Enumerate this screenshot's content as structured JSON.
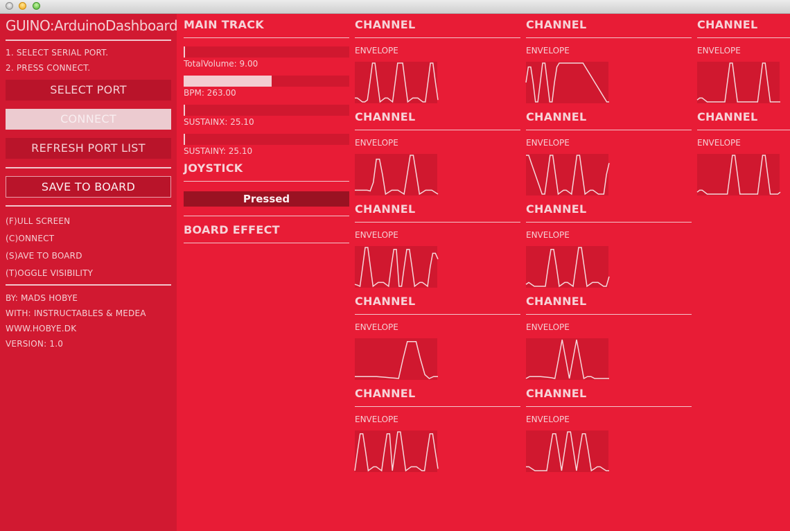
{
  "window": {
    "buttons": [
      "close",
      "minimize",
      "maximize"
    ]
  },
  "sidebar": {
    "title": "GUINO:ArduinoDashboard",
    "steps": [
      "1. SELECT SERIAL PORT.",
      "2. PRESS CONNECT."
    ],
    "buttons": {
      "select_port": "SELECT PORT",
      "connect": "CONNECT",
      "refresh": "REFRESH PORT LIST",
      "save": "SAVE TO BOARD"
    },
    "shortcuts": [
      "(F)ULL SCREEN",
      "(C)ONNECT",
      "(S)AVE TO BOARD",
      "(T)OGGLE VISIBILITY"
    ],
    "credits": [
      "BY: MADS HOBYE",
      "WITH: INSTRUCTABLES & MEDEA",
      "WWW.HOBYE.DK",
      "VERSION: 1.0"
    ]
  },
  "main_track": {
    "title": "MAIN TRACK",
    "sliders": [
      {
        "label": "TotalVolume: 9.00",
        "fraction": 0.0
      },
      {
        "label": "BPM: 263.00",
        "fraction": 0.53
      },
      {
        "label": "SUSTAINX: 25.10",
        "fraction": 0.0
      },
      {
        "label": "SUSTAINY: 25.10",
        "fraction": 0.0
      }
    ],
    "joystick_title": "JOYSTICK",
    "joystick_state": "Pressed",
    "board_effect_title": "BOARD EFFECT"
  },
  "channels": [
    {
      "title": "CHANNEL",
      "subtitle": "ENVELOPE",
      "envelope": [
        0.1,
        0.1,
        0.05,
        0,
        0,
        0.05,
        0.5,
        1,
        1,
        0.5,
        0,
        0.05,
        0.1,
        0.1,
        0.05,
        0,
        0.5,
        1,
        1,
        1,
        0.5,
        0,
        0.05,
        0.1,
        0.1,
        0.1,
        0.05,
        0,
        0,
        0.5,
        1,
        1,
        0.5,
        0.05
      ]
    },
    {
      "title": "CHANNEL",
      "subtitle": "ENVELOPE",
      "envelope": [
        0.5,
        0.9,
        0.9,
        0.5,
        0,
        0,
        0.5,
        1,
        1,
        0.5,
        0,
        0,
        0.5,
        0.9,
        1,
        1,
        1,
        1,
        1,
        1,
        1,
        1,
        1,
        1,
        1,
        0.9,
        0.8,
        0.7,
        0.6,
        0.5,
        0.4,
        0.3,
        0.2,
        0.1,
        0,
        0
      ]
    },
    {
      "title": "CHANNEL",
      "subtitle": "ENVELOPE",
      "envelope": [
        0.05,
        0.1,
        0.1,
        0.05,
        0,
        0,
        0,
        0,
        0,
        0,
        0,
        0,
        0.5,
        1,
        1,
        0.5,
        0,
        0,
        0,
        0,
        0,
        0,
        0,
        0,
        0,
        0.5,
        1,
        1,
        0.5,
        0,
        0,
        0,
        0,
        0
      ]
    },
    {
      "title": "CHANNEL",
      "subtitle": "ENVELOPE",
      "envelope": [
        0.1,
        0.1,
        0.1,
        0.1,
        0.1,
        0.08,
        0.3,
        0.9,
        0.9,
        0.5,
        0,
        0.05,
        0.1,
        0.1,
        0.1,
        0.05,
        0,
        0.5,
        1,
        1,
        0.5,
        0,
        0.05,
        0.1,
        0.1,
        0.1,
        0.05,
        0
      ]
    },
    {
      "title": "CHANNEL",
      "subtitle": "ENVELOPE",
      "envelope": [
        1,
        1,
        0.8,
        0.6,
        0.4,
        0.2,
        0,
        0,
        0.5,
        1,
        1,
        0.5,
        0,
        0.05,
        0.1,
        0.1,
        0.05,
        0,
        0.5,
        1,
        1,
        0.5,
        0,
        0.05,
        0.1,
        0.1,
        0.05,
        0,
        0,
        0,
        0.5,
        0.8
      ]
    },
    {
      "title": "CHANNEL",
      "subtitle": "ENVELOPE",
      "envelope": [
        0.05,
        0.1,
        0.1,
        0.05,
        0,
        0,
        0,
        0,
        0,
        0,
        0,
        0,
        0,
        0.5,
        1,
        1,
        0.5,
        0,
        0,
        0,
        0,
        0,
        0,
        0,
        0,
        0.5,
        1,
        1,
        0.5,
        0,
        0,
        0,
        0,
        0.05
      ]
    },
    {
      "title": "CHANNEL",
      "subtitle": "ENVELOPE",
      "envelope": [
        0.05,
        0.03,
        0,
        0.5,
        1,
        1,
        0.5,
        0,
        0.05,
        0.1,
        0.1,
        0.1,
        0.05,
        0,
        0.5,
        0.95,
        0.95,
        0,
        0,
        0.5,
        0.95,
        0.95,
        0.5,
        0,
        0.05,
        0.1,
        0.1,
        0.05,
        0,
        0.5,
        0.85,
        0.85,
        0.7
      ]
    },
    {
      "title": "CHANNEL",
      "subtitle": "ENVELOPE",
      "envelope": [
        0.05,
        0.1,
        0.05,
        0,
        0,
        0,
        0,
        0,
        0.5,
        0.95,
        0.95,
        0.5,
        0,
        0.05,
        0.1,
        0.1,
        0.05,
        0,
        0.5,
        1,
        1,
        0.5,
        0,
        0.05,
        0.1,
        0.1,
        0.1,
        0.05,
        0,
        0,
        0.25
      ]
    },
    {
      "title": "CHANNEL",
      "subtitle": "ENVELOPE",
      "envelope": [
        0.05,
        0.05,
        0.05,
        0.05,
        0.05,
        0.05,
        0.04,
        0.03,
        0.02,
        0.01,
        0,
        0.5,
        0.95,
        0.95,
        0.95,
        0.5,
        0.1,
        0,
        0.05,
        0.05
      ]
    },
    {
      "title": "CHANNEL",
      "subtitle": "ENVELOPE",
      "envelope": [
        0,
        0.05,
        0.05,
        0.05,
        0.05,
        0.04,
        0.03,
        0.02,
        0,
        0.5,
        1,
        0.5,
        0,
        0.5,
        1,
        0.5,
        0,
        0.05,
        0.05,
        0,
        0,
        0,
        0,
        0
      ]
    },
    {
      "title": "CHANNEL",
      "subtitle": "ENVELOPE",
      "envelope": [
        0,
        0.5,
        0.95,
        0.95,
        0.5,
        0,
        0.05,
        0.1,
        0.1,
        0.05,
        0,
        0.5,
        0.95,
        0.95,
        0,
        0.5,
        1,
        1,
        0.5,
        0,
        0.05,
        0.1,
        0.1,
        0.1,
        0.05,
        0,
        0,
        0.5,
        0.95,
        0.95,
        0.5,
        0.05
      ]
    },
    {
      "title": "CHANNEL",
      "subtitle": "ENVELOPE",
      "envelope": [
        0.1,
        0.1,
        0.05,
        0,
        0,
        0,
        0,
        0,
        0.5,
        0.95,
        0.95,
        0.5,
        0,
        0.5,
        1,
        1,
        0.5,
        0,
        0.5,
        0.95,
        0.95,
        0.5,
        0,
        0.05,
        0.1,
        0.1,
        0.05,
        0,
        0
      ]
    }
  ],
  "colors": {
    "background": "#e81c36",
    "sidebar": "#d11931",
    "panel": "#d0182f",
    "text": "#f4cfd4",
    "pressed": "#9a1222"
  }
}
